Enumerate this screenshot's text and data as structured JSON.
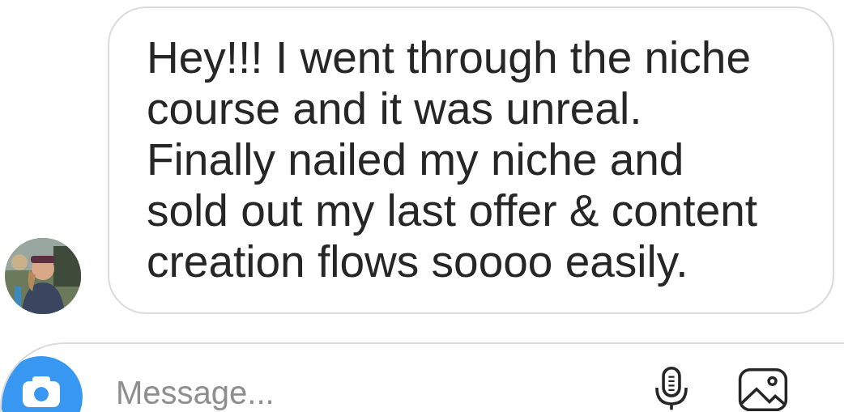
{
  "message": {
    "text": "Hey!!! I went through the niche course and it was unreal. Finally nailed my niche and sold out my last offer & content creation flows soooo easily."
  },
  "composer": {
    "placeholder": "Message..."
  }
}
